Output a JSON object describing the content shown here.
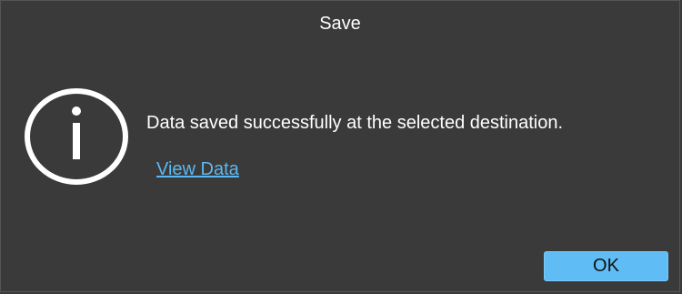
{
  "dialog": {
    "title": "Save",
    "icon": "info-icon",
    "message": "Data saved successfully at the selected destination.",
    "link_label": "View Data",
    "ok_label": "OK"
  },
  "colors": {
    "background": "#3a3a3a",
    "text": "#ffffff",
    "link": "#5cb8f0",
    "button": "#5fbcf5"
  }
}
